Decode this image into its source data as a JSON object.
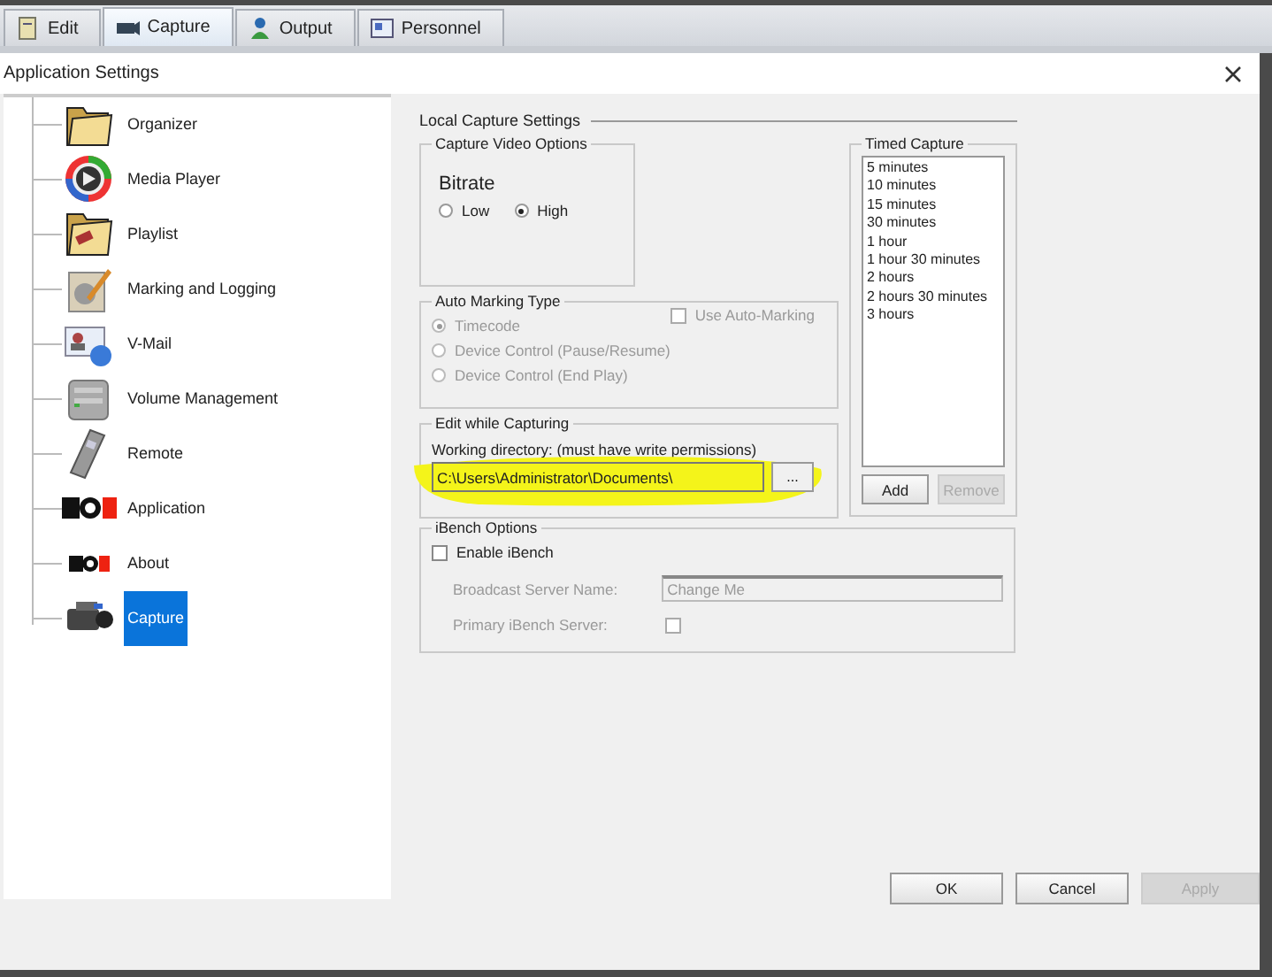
{
  "tabs": [
    {
      "label": "Edit",
      "selected": false
    },
    {
      "label": "Capture",
      "selected": true
    },
    {
      "label": "Output",
      "selected": false
    },
    {
      "label": "Personnel",
      "selected": false
    }
  ],
  "dialog": {
    "title": "Application Settings"
  },
  "sidebar": {
    "items": [
      {
        "label": "Organizer",
        "selected": false
      },
      {
        "label": "Media Player",
        "selected": false
      },
      {
        "label": "Playlist",
        "selected": false
      },
      {
        "label": "Marking and Logging",
        "selected": false
      },
      {
        "label": "V-Mail",
        "selected": false
      },
      {
        "label": "Volume Management",
        "selected": false
      },
      {
        "label": "Remote",
        "selected": false
      },
      {
        "label": "Application",
        "selected": false
      },
      {
        "label": "About",
        "selected": false
      },
      {
        "label": "Capture",
        "selected": true
      }
    ]
  },
  "local_capture": {
    "title": "Local Capture Settings",
    "video_options": {
      "title": "Capture Video Options",
      "bitrate_label": "Bitrate",
      "options": [
        {
          "label": "Low",
          "selected": false
        },
        {
          "label": "High",
          "selected": true
        }
      ]
    },
    "auto_marking": {
      "title": "Auto Marking Type",
      "disabled": true,
      "use_auto": {
        "label": "Use Auto-Marking",
        "checked": false
      },
      "options": [
        {
          "label": "Timecode",
          "selected": true
        },
        {
          "label": "Device Control (Pause/Resume)",
          "selected": false
        },
        {
          "label": "Device Control (End Play)",
          "selected": false
        }
      ]
    },
    "edit_while_capturing": {
      "title": "Edit while Capturing",
      "label": "Working directory: (must have write permissions)",
      "value": "C:\\Users\\Administrator\\Documents\\",
      "browse": "...",
      "highlighted": true
    },
    "timed_capture": {
      "title": "Timed Capture",
      "items": [
        "5 minutes",
        "10 minutes",
        "15 minutes",
        "30 minutes",
        "1 hour",
        "1 hour 30 minutes",
        "2 hours",
        "2 hours 30 minutes",
        "3 hours"
      ],
      "buttons": [
        {
          "label": "Add",
          "disabled": false
        },
        {
          "label": "Remove",
          "disabled": true
        }
      ]
    },
    "ibench": {
      "title": "iBench Options",
      "enable": {
        "label": "Enable iBench",
        "checked": false
      },
      "disabled": true,
      "server_name_label": "Broadcast Server Name:",
      "server_name": "Change Me",
      "primary_label": "Primary iBench Server:",
      "primary_checked": false
    }
  },
  "buttons": [
    {
      "label": "OK",
      "disabled": false
    },
    {
      "label": "Cancel",
      "disabled": false
    },
    {
      "label": "Apply",
      "disabled": true
    }
  ]
}
